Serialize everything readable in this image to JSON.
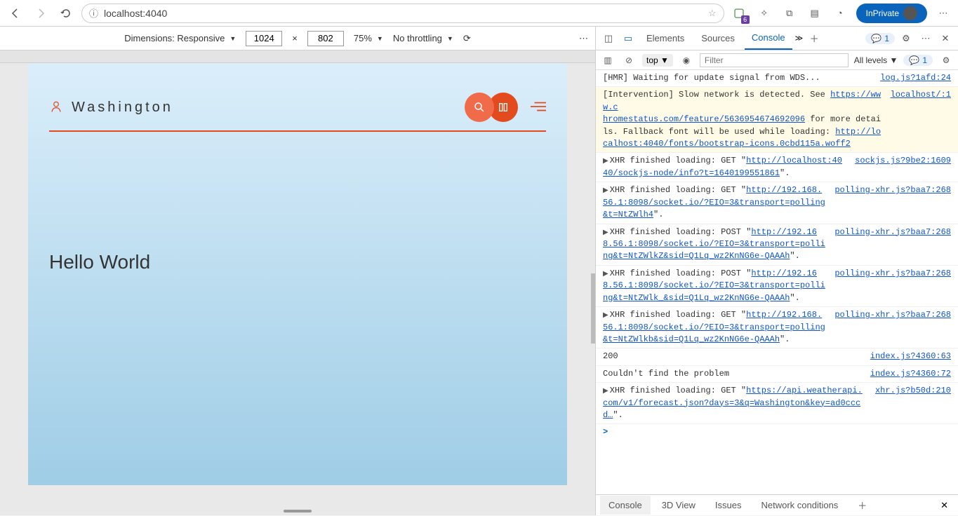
{
  "browser": {
    "url": "localhost:4040",
    "inprivate": "InPrivate",
    "ext_badge": "6"
  },
  "responsive": {
    "dimensions_label": "Dimensions: Responsive",
    "width": "1024",
    "height": "802",
    "x": "×",
    "zoom": "75%",
    "throttling": "No throttling"
  },
  "devtabs": {
    "elements": "Elements",
    "sources": "Sources",
    "console": "Console",
    "issues_count": "1",
    "issues_count2": "1"
  },
  "console_toolbar": {
    "context": "top",
    "filter_placeholder": "Filter",
    "levels": "All levels"
  },
  "app": {
    "location": "Washington",
    "hello": "Hello World"
  },
  "logs": [
    {
      "type": "plain",
      "msg": "[HMR] Waiting for update signal from WDS...",
      "src": "log.js?1afd:24"
    },
    {
      "type": "warn",
      "msg_pre": "[Intervention] Slow network is detected. See ",
      "link1": "https://www.c",
      "src": "localhost/:1",
      "msg_mid": "hromestatus.com/feature/5636954674692096",
      "msg_post": " for more details. Fallback font will be used while loading: ",
      "link2": "http://localhost:4040/fonts/bootstrap-icons.0cbd115a.woff2"
    },
    {
      "type": "xhr",
      "method": "GET",
      "url": "http://localhost:4040/sockjs-node/info?t=1640199551861",
      "src": "sockjs.js?9be2:1609"
    },
    {
      "type": "xhr",
      "method": "GET",
      "url": "http://192.168.56.1:8098/socket.io/?EIO=3&transport=polling&t=NtZWlh4",
      "src": "polling-xhr.js?baa7:268"
    },
    {
      "type": "xhr",
      "method": "POST",
      "url": "http://192.168.56.1:8098/socket.io/?EIO=3&transport=polling&t=NtZWlkZ&sid=Q1Lq_wz2KnNG6e-QAAAh",
      "src": "polling-xhr.js?baa7:268"
    },
    {
      "type": "xhr",
      "method": "POST",
      "url": "http://192.168.56.1:8098/socket.io/?EIO=3&transport=polling&t=NtZWlk_&sid=Q1Lq_wz2KnNG6e-QAAAh",
      "src": "polling-xhr.js?baa7:268"
    },
    {
      "type": "xhr",
      "method": "GET",
      "url": "http://192.168.56.1:8098/socket.io/?EIO=3&transport=polling&t=NtZWlkb&sid=Q1Lq_wz2KnNG6e-QAAAh",
      "src": "polling-xhr.js?baa7:268"
    },
    {
      "type": "plain",
      "msg": "200",
      "src": "index.js?4360:63"
    },
    {
      "type": "plain",
      "msg": "Couldn't find the problem",
      "src": "index.js?4360:72"
    },
    {
      "type": "xhr",
      "method": "GET",
      "url": "https://api.weatherapi.com/v1/forecast.json?days=3&q=Washington&key=ad0cccd…",
      "src": "xhr.js?b50d:210"
    }
  ],
  "bottom_tabs": {
    "console": "Console",
    "view3d": "3D View",
    "issues": "Issues",
    "network": "Network conditions"
  }
}
